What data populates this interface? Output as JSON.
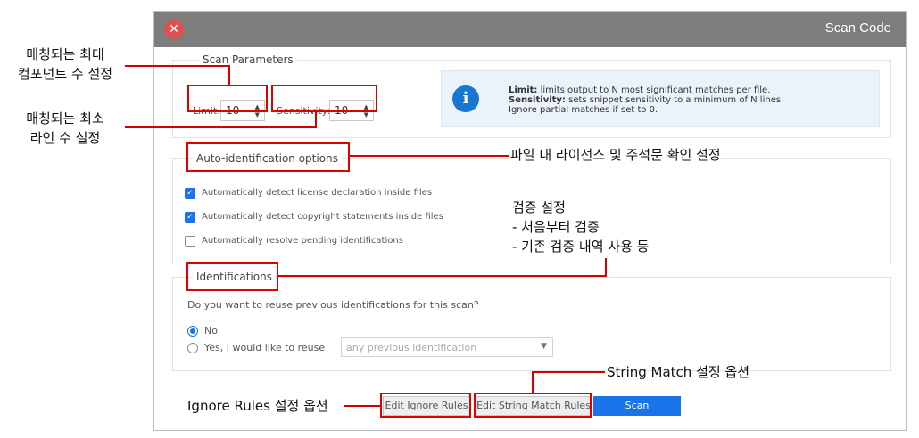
{
  "dialog": {
    "title": "Scan Code",
    "scan_parameters": {
      "legend": "Scan Parameters",
      "limit_label": "Limit:",
      "limit_value": "10",
      "sensitivity_label": "Sensitivity:",
      "sensitivity_value": "10"
    },
    "info": {
      "limit_key": "Limit:",
      "limit_text": " limits output to N most significant matches per file.",
      "sensitivity_key": "Sensitivity:",
      "sensitivity_text": " sets snippet sensitivity to a minimum of N lines.",
      "line3": "Ignore partial matches if set to 0."
    },
    "auto_id": {
      "legend": "Auto-identification options",
      "options": [
        {
          "label": "Automatically detect license declaration inside files",
          "checked": true
        },
        {
          "label": "Automatically detect copyright statements inside files",
          "checked": true
        },
        {
          "label": "Automatically resolve pending identifications",
          "checked": false
        }
      ]
    },
    "identifications": {
      "legend": "Identifications",
      "question": "Do you want to reuse previous identifications for this scan?",
      "option_no": "No",
      "option_yes": "Yes, I would like to reuse",
      "selected": "No",
      "select_placeholder": "any previous identification"
    },
    "buttons": {
      "edit_ignore": "Edit Ignore Rules",
      "edit_string_match": "Edit String Match Rules",
      "scan": "Scan"
    }
  },
  "annotations": {
    "max_components_line1": "매칭되는 최대",
    "max_components_line2": "컴포넌트 수 설정",
    "min_lines_line1": "매칭되는 최소",
    "min_lines_line2": "라인 수 설정",
    "license_copyright": "파일 내 라이선스 및 주석문 확인 설정",
    "verify_title": "검증 설정",
    "verify_item1": "-  처음부터 검증",
    "verify_item2": "-  기존 검증 내역 사용 등",
    "string_match": "String Match 설정 옵션",
    "ignore_rules": "Ignore Rules 설정 옵션"
  },
  "colors": {
    "annotation_red": "#e00000",
    "title_bar": "#7d7d7d",
    "accent_blue": "#1a73e8",
    "close_red": "#e05050"
  },
  "icons": [
    "close-icon",
    "info-icon",
    "checkbox-icon",
    "radio-icon",
    "chevron-down-icon",
    "spinner-up-icon",
    "spinner-down-icon"
  ]
}
